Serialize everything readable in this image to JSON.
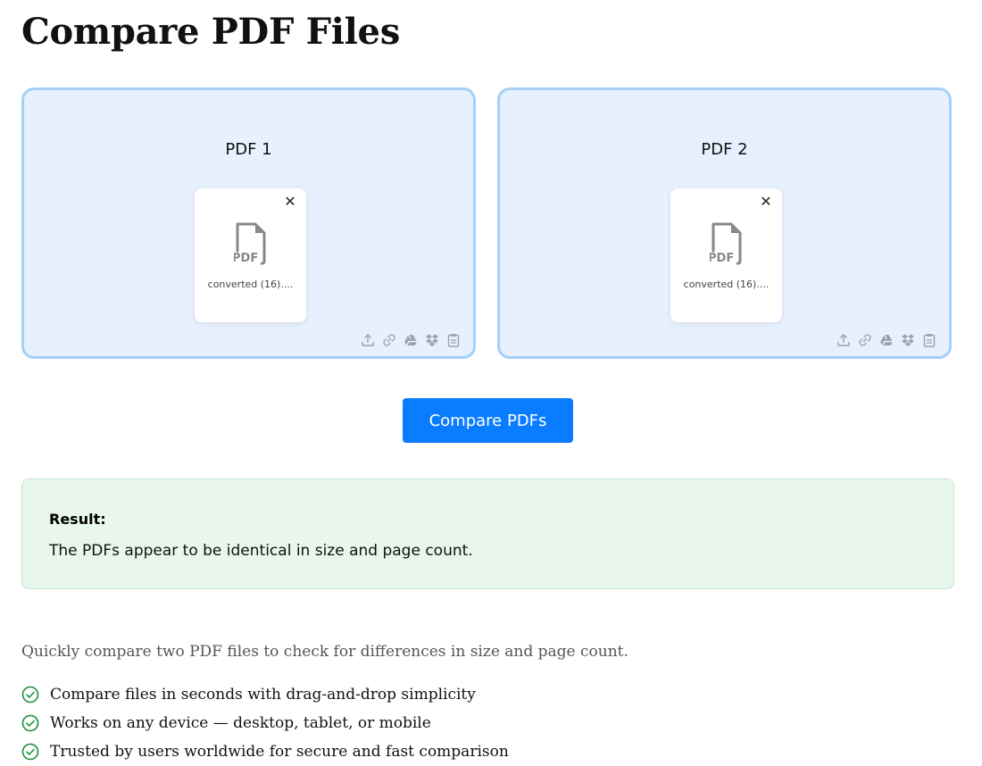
{
  "page": {
    "title": "Compare PDF Files"
  },
  "drop_zones": [
    {
      "label": "PDF 1",
      "file": {
        "name": "converted (16)....",
        "type_badge": "PDF"
      }
    },
    {
      "label": "PDF 2",
      "file": {
        "name": "converted (16)....",
        "type_badge": "PDF"
      }
    }
  ],
  "source_icons": [
    "upload-icon",
    "link-icon",
    "google-drive-icon",
    "dropbox-icon",
    "clipboard-icon"
  ],
  "compare_button": {
    "label": "Compare PDFs"
  },
  "result": {
    "label": "Result:",
    "text": "The PDFs appear to be identical in size and page count."
  },
  "description": "Quickly compare two PDF files to check for differences in size and page count.",
  "features": [
    "Compare files in seconds with drag-and-drop simplicity",
    "Works on any device — desktop, tablet, or mobile",
    "Trusted by users worldwide for secure and fast comparison"
  ],
  "colors": {
    "primary": "#0a7cff",
    "drop_zone_bg": "#e7f0fe",
    "drop_zone_border": "#a6d1f7",
    "result_bg": "#e8f6ec",
    "check": "#1a8f3c"
  }
}
